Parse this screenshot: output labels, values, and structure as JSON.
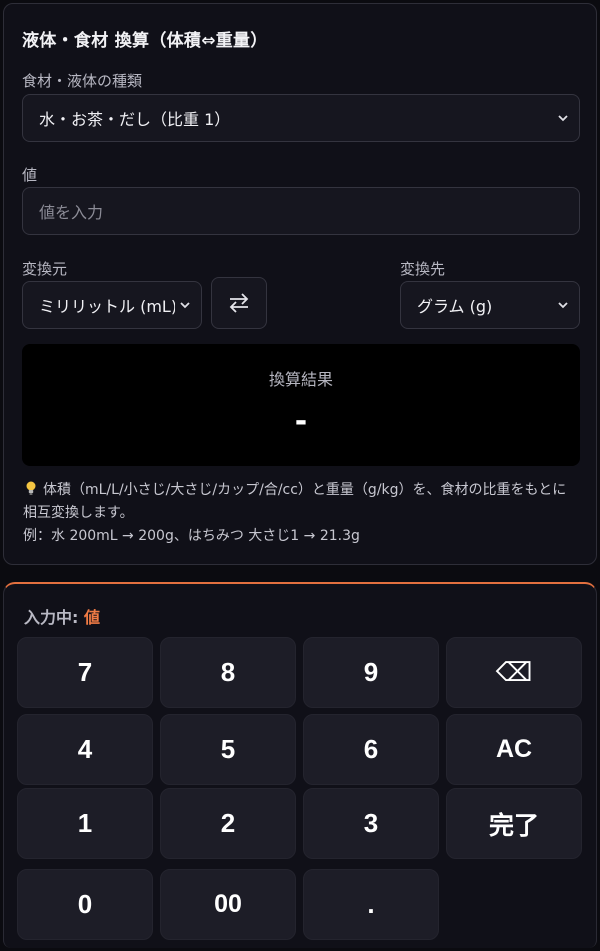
{
  "converter": {
    "title": "液体・食材 換算（体積⇔重量）",
    "ingredient_label": "食材・液体の種類",
    "ingredient_selected": "水・お茶・だし（比重 1）",
    "value_label": "値",
    "value_placeholder": "値を入力",
    "from_label": "変換元",
    "from_selected": "ミリリットル (mL)",
    "to_label": "変換先",
    "to_selected": "グラム (g)",
    "result_label": "換算結果",
    "result_value": "-",
    "note_line1": "体積（mL/L/小さじ/大さじ/カップ/合/cc）と重量（g/kg）を、食材の比重をもとに相互変換します。",
    "note_line2": "例：水 200mL → 200g、はちみつ 大さじ1 → 21.3g"
  },
  "keypad": {
    "status_prefix": "入力中:",
    "status_field": "値",
    "keys": {
      "k7": "7",
      "k8": "8",
      "k9": "9",
      "backspace": "⌫",
      "k4": "4",
      "k5": "5",
      "k6": "6",
      "clear": "AC",
      "k1": "1",
      "k2": "2",
      "k3": "3",
      "done": "完了",
      "k0": "0",
      "k00": "00",
      "dot": "."
    }
  },
  "colors": {
    "accent": "#f07b45",
    "background": "#0b0b10",
    "card": "#101018",
    "key": "#1d1d27"
  },
  "icons": {
    "swap": "swap-arrows-icon",
    "dropdown": "chevron-down-icon",
    "hint": "lightbulb-icon"
  }
}
